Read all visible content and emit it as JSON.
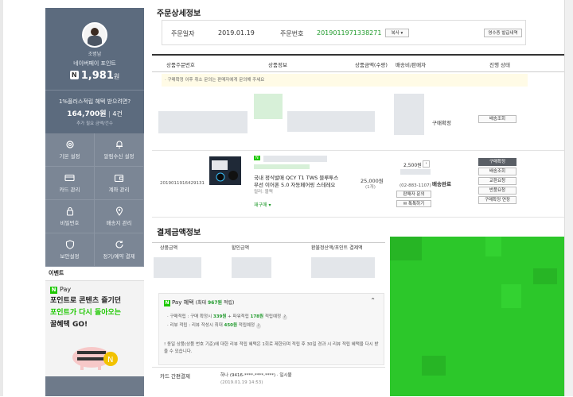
{
  "sidebar": {
    "username": "조병남",
    "points_label": "네이버페이 포인트",
    "points_value": "1,981",
    "points_unit": "원",
    "plus_question": "1%플러스적립 혜택 받으려면?",
    "plus_amount": "164,700원",
    "plus_count": "4건",
    "plus_sub": "추가 필요 금액/건수",
    "tiles": [
      {
        "label": "기본 설정",
        "icon": "gear-icon"
      },
      {
        "label": "알림수신 설정",
        "icon": "bell-icon"
      },
      {
        "label": "카드 관리",
        "icon": "card-icon"
      },
      {
        "label": "계좌 관리",
        "icon": "wallet-icon"
      },
      {
        "label": "비밀번호",
        "icon": "lock-icon"
      },
      {
        "label": "배송지 관리",
        "icon": "location-icon"
      },
      {
        "label": "보안설정",
        "icon": "shield-icon"
      },
      {
        "label": "정기/예약 결제",
        "icon": "refresh-icon"
      }
    ],
    "event_title": "이벤트",
    "banner_brand": "Pay",
    "banner_line1": "포인트로 콘텐츠 즐기던",
    "banner_line2a": "포인트가 다시 돌아오는",
    "banner_line3": "꿀혜택 GO!"
  },
  "order": {
    "section_title": "주문상세정보",
    "date_label": "주문일자",
    "date_value": "2019.01.19",
    "number_label": "주문번호",
    "number_value": "2019011971338271",
    "copy_btn": "복사",
    "receipt_btn": "영수증 발급내역",
    "headers": [
      "상품주문번호",
      "상품정보",
      "상품금액(수량)",
      "배송비/판매자",
      "진행 상태"
    ],
    "notice": "· 구매확정 이후 취소 문의는 판매자에게 문의해 주세요",
    "row1": {
      "status": "구매확정",
      "btn": "배송조회"
    },
    "row2": {
      "order_no": "2019011916429131",
      "badge": "N",
      "product_name_1": "국내 정식발매 QCY T1 TWS 블루투스",
      "product_name_2": "무선 이어폰 5.0 자동페어링 스테레오",
      "option": "컬러: 블랙",
      "reorder": "재구매",
      "price": "25,000원",
      "qty": "(1개)",
      "shipping": "2,500원",
      "seller_phone": "(02-883-1107)",
      "seller_contact_btn": "판매자 문의",
      "talk_btn": "톡톡하기",
      "status": "배송완료",
      "actions": [
        "구매확정",
        "배송조회",
        "교환요청",
        "반품요청",
        "구매확정 연장"
      ]
    }
  },
  "payment": {
    "section_title": "결제금액정보",
    "headers": [
      "상품금액",
      "할인금액",
      "환불정산액/포인트 결제액"
    ],
    "benefit_title": "Pay 혜택",
    "benefit_max_prefix": "(최대 ",
    "benefit_max": "967원",
    "benefit_max_suffix": " 적립)",
    "line1_prefix": "· 구매적립 : 구매 확정시 ",
    "line1_v1": "339원",
    "line1_mid": " + 파워적립 ",
    "line1_v2": "178원",
    "line1_suffix": " 적립예정",
    "line2_prefix": "· 리뷰 적립 : 리뷰 작성시 최대 ",
    "line2_v": "450원",
    "line2_suffix": " 적립예정",
    "note": "! 동일 상품(상품 번호 기준)에 대한 리뷰 적립 혜택은 1회로 제한되며 적립 후 30일 경과 시 리뷰 적립 혜택을 다시 받을 수 있습니다.",
    "card_label": "카드 간편결제",
    "card_value": "하나 (9416-****-****-****) · 일시불",
    "card_date": "(2019.01.19 14:53)"
  }
}
